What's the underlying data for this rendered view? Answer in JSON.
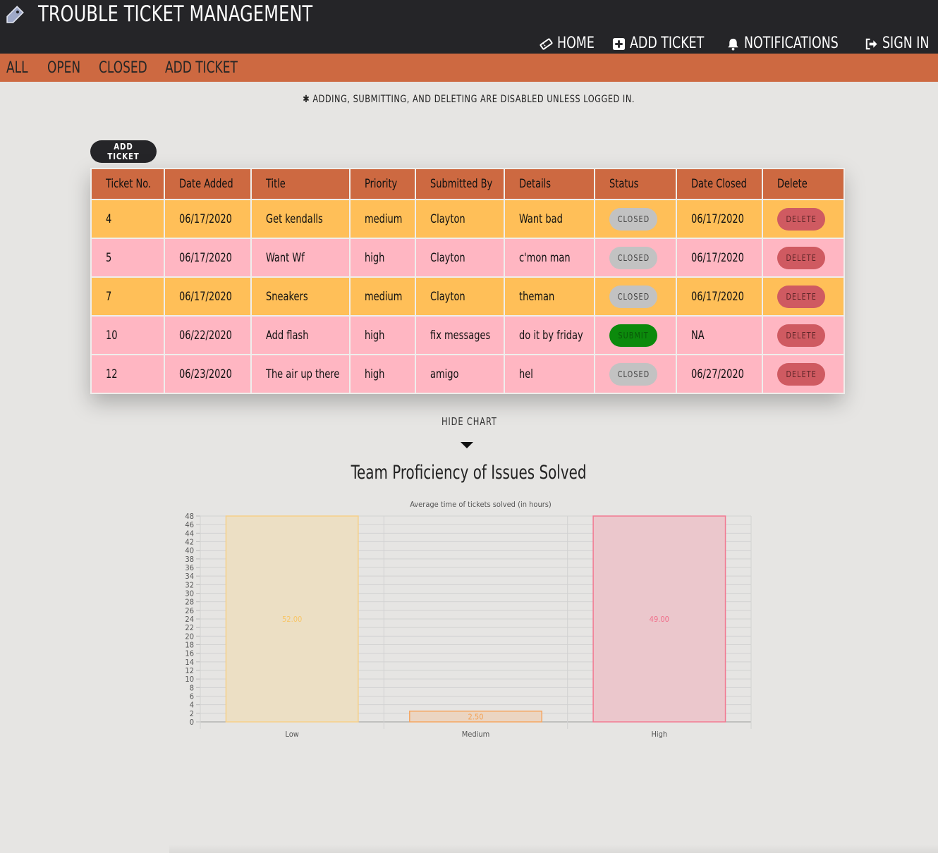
{
  "header": {
    "title": "TROUBLE TICKET MANAGEMENT",
    "app_icon": "tag-icon",
    "nav": [
      {
        "label": "HOME",
        "icon": "ticket-icon"
      },
      {
        "label": "ADD TICKET",
        "icon": "plus-square-icon"
      },
      {
        "label": "NOTIFICATIONS",
        "icon": "bell-icon"
      },
      {
        "label": "SIGN IN",
        "icon": "sign-in-icon"
      }
    ]
  },
  "subnav": {
    "items": [
      "ALL",
      "OPEN",
      "CLOSED",
      "ADD TICKET"
    ]
  },
  "notice": "✱ ADDING, SUBMITTING, AND DELETING ARE DISABLED UNLESS LOGGED IN.",
  "add_ticket_button": "ADD TICKET",
  "table": {
    "headers": [
      "Ticket No.",
      "Date Added",
      "Title",
      "Priority",
      "Submitted By",
      "Details",
      "Status",
      "Date Closed",
      "Delete"
    ],
    "rows": [
      {
        "ticket_no": "4",
        "date_added": "06/17/2020",
        "title": "Get kendalls",
        "priority": "medium",
        "submitted_by": "Clayton",
        "details": "Want bad",
        "status": "CLOSED",
        "date_closed": "06/17/2020",
        "delete": "DELETE"
      },
      {
        "ticket_no": "5",
        "date_added": "06/17/2020",
        "title": "Want Wf",
        "priority": "high",
        "submitted_by": "Clayton",
        "details": "c'mon man",
        "status": "CLOSED",
        "date_closed": "06/17/2020",
        "delete": "DELETE"
      },
      {
        "ticket_no": "7",
        "date_added": "06/17/2020",
        "title": "Sneakers",
        "priority": "medium",
        "submitted_by": "Clayton",
        "details": "theman",
        "status": "CLOSED",
        "date_closed": "06/17/2020",
        "delete": "DELETE"
      },
      {
        "ticket_no": "10",
        "date_added": "06/22/2020",
        "title": "Add flash",
        "priority": "high",
        "submitted_by": "fix messages",
        "details": "do it by friday",
        "status": "SUBMIT",
        "date_closed": "NA",
        "delete": "DELETE"
      },
      {
        "ticket_no": "12",
        "date_added": "06/23/2020",
        "title": "The air up there",
        "priority": "high",
        "submitted_by": "amigo",
        "details": "hel",
        "status": "CLOSED",
        "date_closed": "06/27/2020",
        "delete": "DELETE"
      }
    ]
  },
  "hide_chart_label": "HIDE CHART",
  "chart_data": {
    "type": "bar",
    "title": "Team Proficiency of Issues Solved",
    "subtitle": "Average time of tickets solved (in hours)",
    "categories": [
      "Low",
      "Medium",
      "High"
    ],
    "values": [
      52.0,
      2.5,
      49.0
    ],
    "value_labels": [
      "52.00",
      "2.50",
      "49.00"
    ],
    "ylim": [
      0,
      48
    ],
    "yticks": [
      0,
      2,
      4,
      6,
      8,
      10,
      12,
      14,
      16,
      18,
      20,
      22,
      24,
      26,
      28,
      30,
      32,
      34,
      36,
      38,
      40,
      42,
      44,
      46,
      48
    ],
    "grid": true,
    "colors": {
      "fill": [
        "#ecdfc4",
        "#ebd5c2",
        "#ebc7cc"
      ],
      "stroke": [
        "#f6d089",
        "#f5a662",
        "#f27a92"
      ],
      "label": [
        "#f8c565",
        "#f3a154",
        "#f16e8a"
      ]
    }
  }
}
